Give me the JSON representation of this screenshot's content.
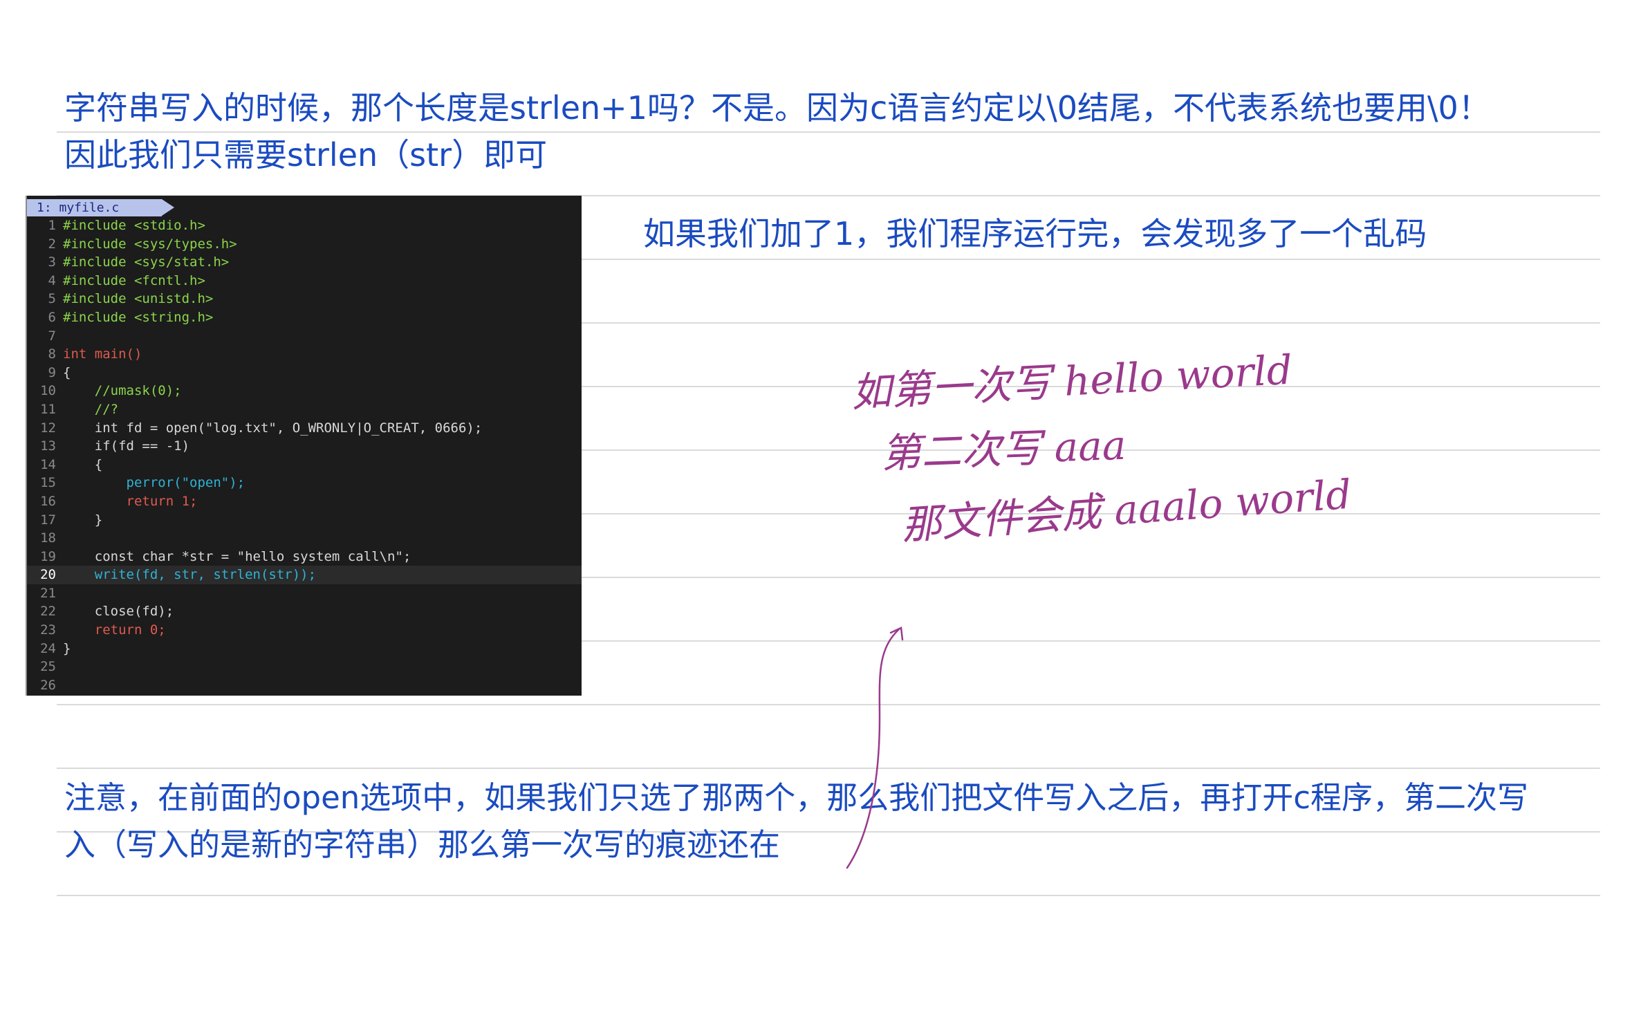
{
  "notes": {
    "line1": "字符串写入的时候，那个长度是strlen+1吗？不是。因为c语言约定以\\0结尾，不代表系统也要用\\0！",
    "line2": "因此我们只需要strlen（str）即可",
    "right_note": "如果我们加了1，我们程序运行完，会发现多了一个乱码",
    "bottom_line1": "注意，在前面的open选项中，如果我们只选了那两个，那么我们把文件写入之后，再打开c程序，第二次写",
    "bottom_line2": "入（写入的是新的字符串）那么第一次写的痕迹还在"
  },
  "code": {
    "tab_label": "1: myfile.c",
    "lines": [
      {
        "n": "1",
        "text": "#include <stdio.h>"
      },
      {
        "n": "2",
        "text": "#include <sys/types.h>"
      },
      {
        "n": "3",
        "text": "#include <sys/stat.h>"
      },
      {
        "n": "4",
        "text": "#include <fcntl.h>"
      },
      {
        "n": "5",
        "text": "#include <unistd.h>"
      },
      {
        "n": "6",
        "text": "#include <string.h>"
      },
      {
        "n": "7",
        "text": ""
      },
      {
        "n": "8",
        "text": "int main()"
      },
      {
        "n": "9",
        "text": "{"
      },
      {
        "n": "10",
        "text": "    //umask(0);"
      },
      {
        "n": "11",
        "text": "    //?"
      },
      {
        "n": "12",
        "text": "    int fd = open(\"log.txt\", O_WRONLY|O_CREAT, 0666);"
      },
      {
        "n": "13",
        "text": "    if(fd == -1)"
      },
      {
        "n": "14",
        "text": "    {"
      },
      {
        "n": "15",
        "text": "        perror(\"open\");"
      },
      {
        "n": "16",
        "text": "        return 1;"
      },
      {
        "n": "17",
        "text": "    }"
      },
      {
        "n": "18",
        "text": ""
      },
      {
        "n": "19",
        "text": "    const char *str = \"hello system call\\n\";"
      },
      {
        "n": "20",
        "text": "    write(fd, str, strlen(str));"
      },
      {
        "n": "21",
        "text": ""
      },
      {
        "n": "22",
        "text": "    close(fd);"
      },
      {
        "n": "23",
        "text": "    return 0;"
      },
      {
        "n": "24",
        "text": "}"
      },
      {
        "n": "25",
        "text": ""
      },
      {
        "n": "26",
        "text": ""
      }
    ]
  },
  "handwriting": {
    "line1": "如第一次写  hello world",
    "line2": "第二次写  aaa",
    "line3": "那文件会成  aaalo world"
  },
  "colors": {
    "note_text": "#1a4bc0",
    "handwriting_ink": "#9a3a8c",
    "code_bg": "#1c1c1c"
  }
}
